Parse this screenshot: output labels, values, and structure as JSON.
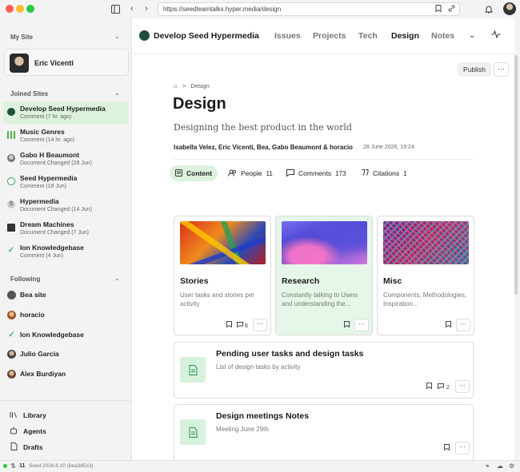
{
  "browser": {
    "url": "https://seedteamtalks.hyper.media/design"
  },
  "sidebar": {
    "my_site_label": "My Site",
    "user_name": "Eric Vicenti",
    "joined_label": "Joined Sites",
    "joined": [
      {
        "name": "Develop Seed Hypermedia",
        "sub": "Comment",
        "time": "(7 hr. ago)",
        "icon": "seed-logo-icon",
        "color": "#1f4f3a"
      },
      {
        "name": "Music Genres",
        "sub": "Comment",
        "time": "(14 hr. ago)",
        "icon": "grid-dots-icon",
        "color": "#4caf50"
      },
      {
        "name": "Gabo H Beaumont",
        "sub": "Document Changed",
        "time": "(28 Jun)",
        "icon": "avatar-icon",
        "color": "#999999"
      },
      {
        "name": "Seed Hypermedia",
        "sub": "Comment",
        "time": "(18 Jun)",
        "icon": "seed-leaf-icon",
        "color": "#2e9e5b"
      },
      {
        "name": "Hypermedia",
        "sub": "Document Changed",
        "time": "(14 Jun)",
        "icon": "dollar-icon",
        "color": "#888888"
      },
      {
        "name": "Dream Machines",
        "sub": "Document Changed",
        "time": "(7 Jun)",
        "icon": "machine-icon",
        "color": "#333333"
      },
      {
        "name": "Ion Knowledgebase",
        "sub": "Comment",
        "time": "(4 Jun)",
        "icon": "ion-icon",
        "color": "#3cb371"
      }
    ],
    "following_label": "Following",
    "following": [
      {
        "name": "Bea site",
        "color": "#555555"
      },
      {
        "name": "horacio",
        "color": "#a0522d"
      },
      {
        "name": "Ion Knowledgebase",
        "color": "#3cb371"
      },
      {
        "name": "Julio Garcia",
        "color": "#444444"
      },
      {
        "name": "Alex Burdiyan",
        "color": "#6b4a3a"
      }
    ],
    "bottom": [
      {
        "label": "Library",
        "icon": "library-icon"
      },
      {
        "label": "Agents",
        "icon": "agents-icon"
      },
      {
        "label": "Drafts",
        "icon": "drafts-icon"
      }
    ]
  },
  "status": {
    "count": "11",
    "version": "Seed 2026.6.10 (6ea385c3)"
  },
  "topnav": {
    "brand": "Develop Seed Hypermedia",
    "tabs": [
      "Issues",
      "Projects",
      "Tech",
      "Design",
      "Notes"
    ],
    "active_tab": "Design"
  },
  "actions": {
    "publish": "Publish",
    "more": "···"
  },
  "document": {
    "breadcrumb": "Design",
    "title": "Design",
    "subtitle": "Designing the best product in the world",
    "authors": "Isabella Velez, Eric Vicenti, Bea, Gabo Beaumont & horacio",
    "date": "28 June 2026, 19:24"
  },
  "doc_tabs": [
    {
      "label": "Content",
      "count": ""
    },
    {
      "label": "People",
      "count": "11"
    },
    {
      "label": "Comments",
      "count": "173"
    },
    {
      "label": "Citations",
      "count": "1"
    }
  ],
  "cards": [
    {
      "title": "Stories",
      "desc": "User tasks and stories per activity",
      "comments": "6"
    },
    {
      "title": "Research",
      "desc": "Constantly talking to Users and understanding the...",
      "comments": ""
    },
    {
      "title": "Misc",
      "desc": "Components, Methodologies, Inspiration...",
      "comments": ""
    }
  ],
  "list_docs": [
    {
      "title": "Pending user tasks and design tasks",
      "desc": "List of design tasks by activity",
      "comments": "2"
    },
    {
      "title": "Design meetings Notes",
      "desc": "Meeting June 29th",
      "comments": ""
    }
  ]
}
